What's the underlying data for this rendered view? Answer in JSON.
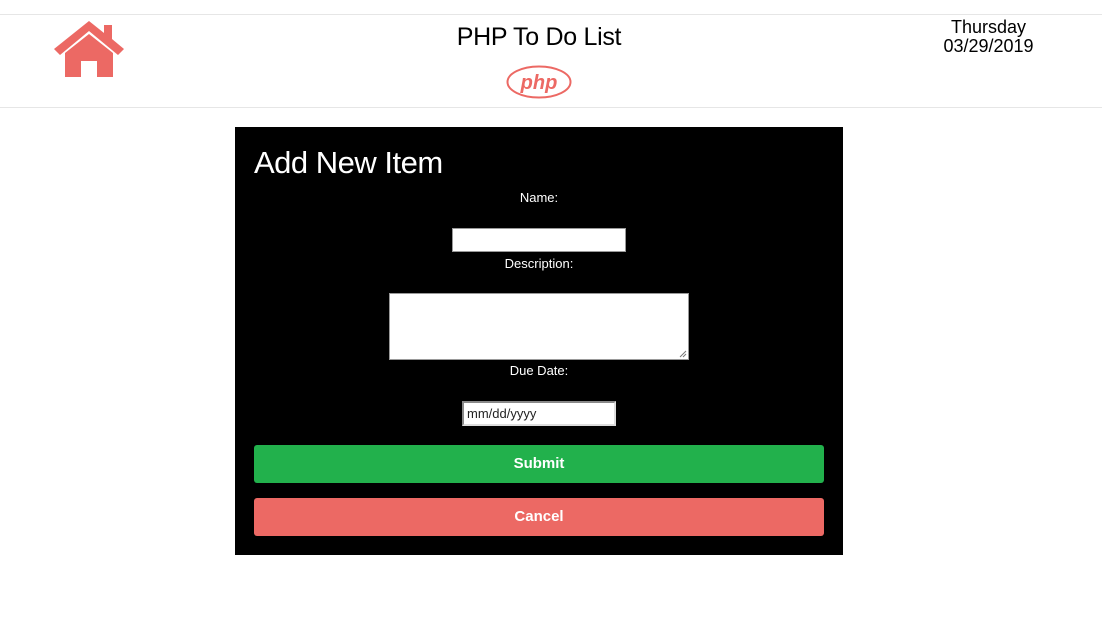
{
  "header": {
    "title": "PHP To Do List",
    "logo_text": "php",
    "day": "Thursday",
    "date": "03/29/2019"
  },
  "form": {
    "heading": "Add New Item",
    "name_label": "Name:",
    "name_value": "",
    "description_label": "Description:",
    "description_value": "",
    "due_date_label": "Due Date:",
    "due_date_placeholder": "mm/dd/yyyy",
    "submit_label": "Submit",
    "cancel_label": "Cancel"
  },
  "colors": {
    "accent": "#ec6964",
    "submit": "#22b14c",
    "cancel": "#ec6964",
    "panel": "#000000"
  },
  "icons": [
    "home-icon",
    "php-logo-icon",
    "resize-grip-icon"
  ]
}
